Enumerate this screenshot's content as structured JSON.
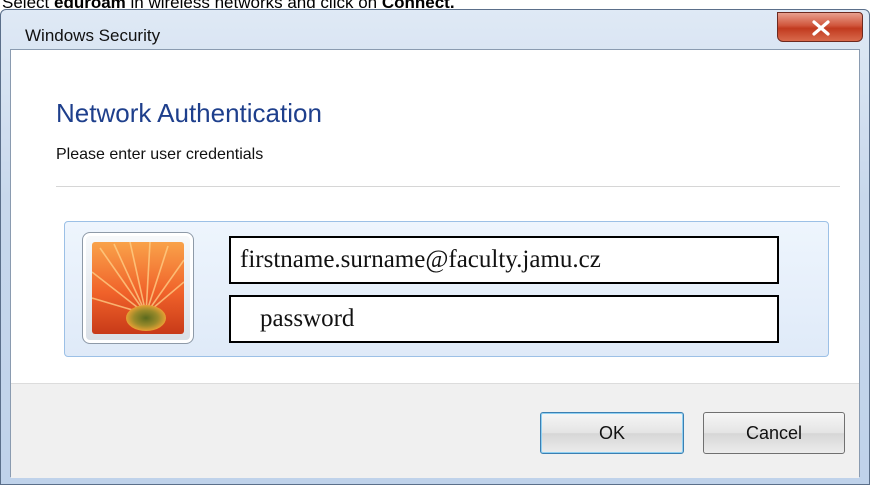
{
  "caption": {
    "part1": "Select ",
    "bold1": "eduroam",
    "part2": " in wireless networks and click on ",
    "bold2": "Connect."
  },
  "window": {
    "title": "Windows Security",
    "close_glyph": "x"
  },
  "dialog": {
    "heading": "Network Authentication",
    "subheading": "Please enter user credentials"
  },
  "credentials": {
    "username_value": "firstname.surname@faculty.jamu.cz",
    "password_value": "password"
  },
  "buttons": {
    "ok_label": "OK",
    "cancel_label": "Cancel"
  },
  "colors": {
    "heading": "#1e3f8c",
    "close_button": "#c13a1f"
  }
}
